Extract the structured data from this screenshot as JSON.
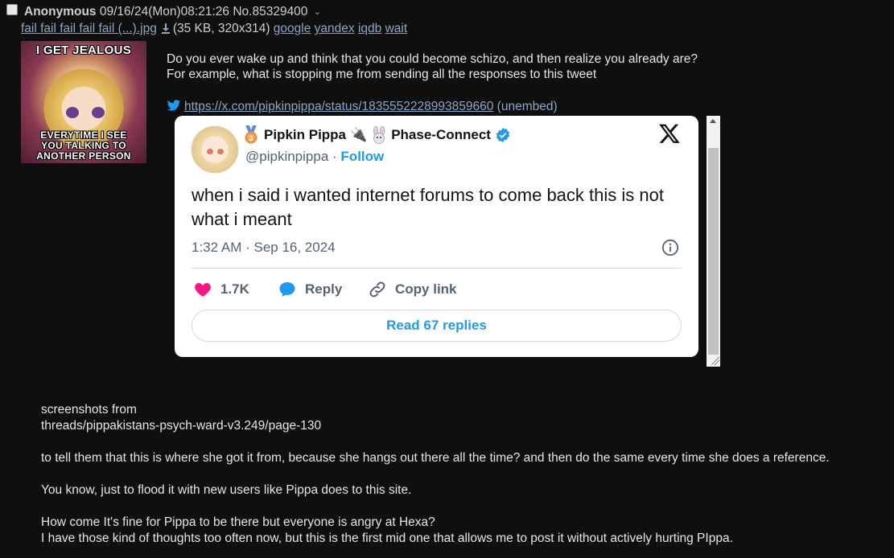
{
  "header": {
    "name": "Anonymous",
    "datetime": "09/16/24(Mon)08:21:26",
    "post_no": "No.85329400"
  },
  "file": {
    "filename": "fail fail fail fail fail (...).jpg",
    "info": "(35 KB, 320x314)",
    "links": [
      "google",
      "yandex",
      "iqdb",
      "wait"
    ]
  },
  "thumbnail": {
    "caption_top": "I GET JEALOUS",
    "caption_bottom_1": "EVERYTIME I SEE",
    "caption_bottom_2": "YOU TALKING TO",
    "caption_bottom_3": "ANOTHER PERSON"
  },
  "post": {
    "line1": "Do you ever wake up and think that you could become schizo, and then realize you already are?",
    "line2": "For example, what is stopping me from sending all the responses to this tweet",
    "tweet_url": "https://x.com/pipkinpippa/status/1835552228993859660",
    "unembed": "(unembed)"
  },
  "tweet": {
    "display_name": "Pipkin Pippa",
    "name_suffix": "Phase-Connect",
    "handle": "@pipkinpippa",
    "separator": "·",
    "follow": "Follow",
    "text": "when i said i wanted internet forums to come back this is not what i meant",
    "date": "1:32 AM · Sep 16, 2024",
    "likes": "1.7K",
    "reply": "Reply",
    "copy_link": "Copy link",
    "read_replies": "Read 67 replies"
  },
  "body": {
    "l1": "screenshots from",
    "l2": "threads/pippakistans-psych-ward-v3.249/page-130",
    "l3": "to tell them that this is where she got it from, because she hangs out there all the time? and then do the same every time she does a reference.",
    "l4": "You know, just to flood it with new users like Pippa does to this site.",
    "l5": "How come It's fine for Pippa to be there but everyone is angry at Hexa?",
    "l6": "I have those kind of thoughts too often now, but this is the first mid one that allows me to post it without actively hurting PIppa."
  },
  "colors": {
    "background": "#0f0f0f",
    "link": "#8aa7c6",
    "twitter_blue": "#1d9bf0",
    "like_pink": "#f91880"
  },
  "icons": [
    "checkbox",
    "chevron-down-icon",
    "download-icon",
    "twitter-bird-icon",
    "medal-icon",
    "plug-icon",
    "bunny-icon",
    "verified-badge-icon",
    "x-logo-icon",
    "info-icon",
    "heart-icon",
    "reply-icon",
    "link-icon"
  ]
}
